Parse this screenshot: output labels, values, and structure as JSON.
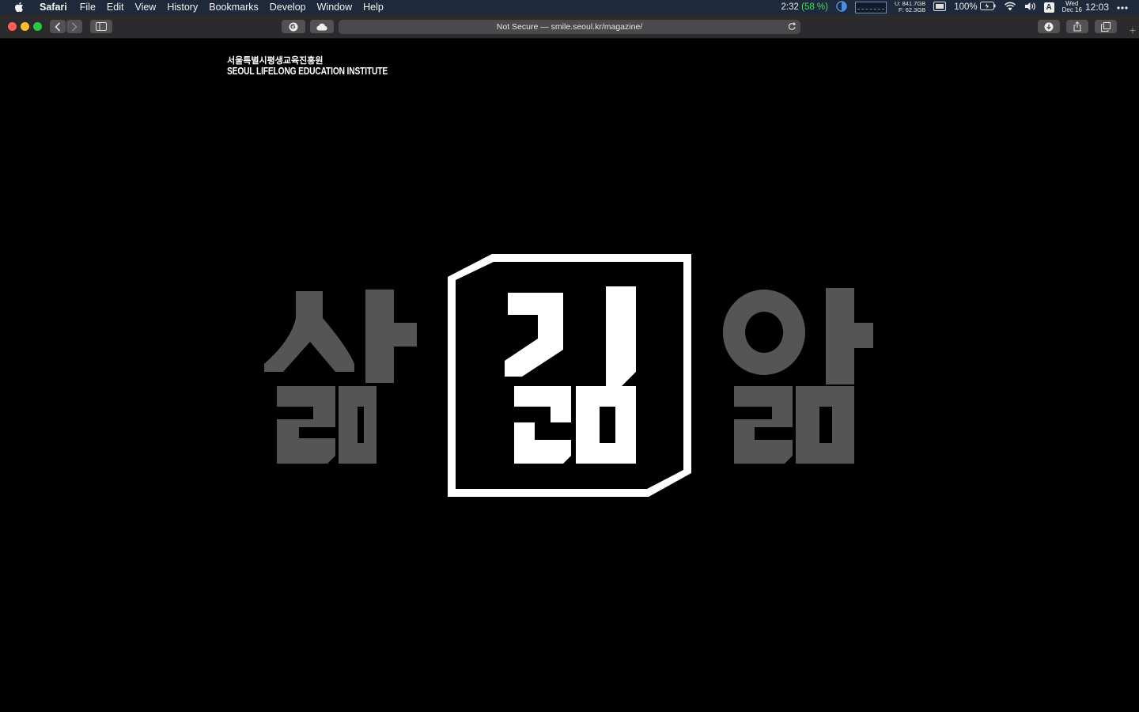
{
  "menubar": {
    "app_name": "Safari",
    "menus": [
      "File",
      "Edit",
      "View",
      "History",
      "Bookmarks",
      "Develop",
      "Window",
      "Help"
    ],
    "battery_time": "2:32",
    "battery_pct_paren": "(58 %)",
    "disk_used": "U: 841.7GB",
    "disk_free": "F:  62.3GB",
    "battery_level": "100%",
    "keyboard_input": "A",
    "date": "Wed\nDec 16",
    "date_day": "Wed",
    "date_month": "Dec 16",
    "clock": "12:03"
  },
  "toolbar": {
    "address_text": "Not Secure — smile.seoul.kr/magazine/"
  },
  "page": {
    "logo_korean": "서울특별시평생교육진흥원",
    "logo_english": "SEOUL LIFELONG EDUCATION INSTITUTE"
  },
  "colors": {
    "background": "#000000",
    "hero_gray": "#555555",
    "hero_white": "#ffffff"
  },
  "icons": {
    "apple": "apple-icon",
    "back": "chevron-left-icon",
    "forward": "chevron-right-icon",
    "sidebar": "sidebar-icon",
    "reload": "reload-icon"
  }
}
